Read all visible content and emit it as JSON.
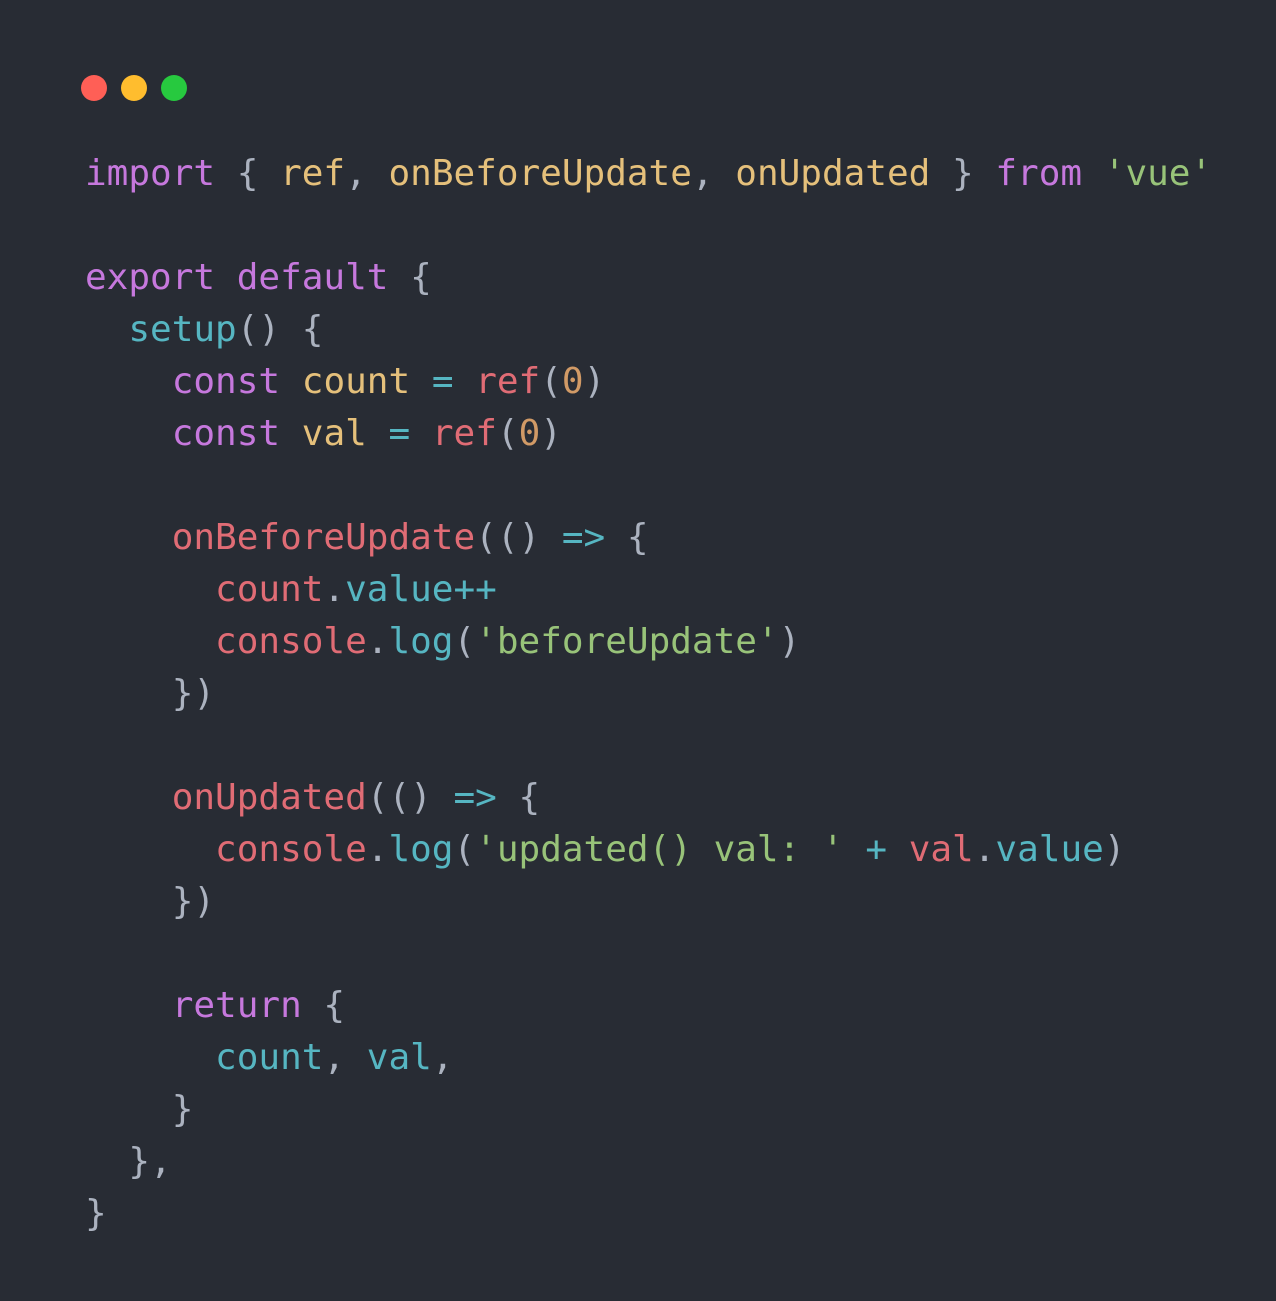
{
  "window": {
    "controls": {
      "close_color": "#ff5f56",
      "minimize_color": "#ffbd2e",
      "zoom_color": "#27c93f"
    }
  },
  "code": {
    "language": "javascript",
    "lines": [
      [
        {
          "t": "import",
          "c": "keyword"
        },
        {
          "t": " { ",
          "c": "punct"
        },
        {
          "t": "ref",
          "c": "import"
        },
        {
          "t": ", ",
          "c": "punct"
        },
        {
          "t": "onBeforeUpdate",
          "c": "import"
        },
        {
          "t": ", ",
          "c": "punct"
        },
        {
          "t": "onUpdated",
          "c": "import"
        },
        {
          "t": " } ",
          "c": "punct"
        },
        {
          "t": "from",
          "c": "keyword"
        },
        {
          "t": " ",
          "c": "plain"
        },
        {
          "t": "'vue'",
          "c": "string"
        }
      ],
      [],
      [
        {
          "t": "export",
          "c": "keyword"
        },
        {
          "t": " ",
          "c": "plain"
        },
        {
          "t": "default",
          "c": "keyword"
        },
        {
          "t": " {",
          "c": "punct"
        }
      ],
      [
        {
          "t": "  ",
          "c": "plain"
        },
        {
          "t": "setup",
          "c": "func"
        },
        {
          "t": "() {",
          "c": "punct"
        }
      ],
      [
        {
          "t": "    ",
          "c": "plain"
        },
        {
          "t": "const",
          "c": "keyword"
        },
        {
          "t": " ",
          "c": "plain"
        },
        {
          "t": "count",
          "c": "decl"
        },
        {
          "t": " ",
          "c": "plain"
        },
        {
          "t": "=",
          "c": "op"
        },
        {
          "t": " ",
          "c": "plain"
        },
        {
          "t": "ref",
          "c": "var"
        },
        {
          "t": "(",
          "c": "punct"
        },
        {
          "t": "0",
          "c": "num"
        },
        {
          "t": ")",
          "c": "punct"
        }
      ],
      [
        {
          "t": "    ",
          "c": "plain"
        },
        {
          "t": "const",
          "c": "keyword"
        },
        {
          "t": " ",
          "c": "plain"
        },
        {
          "t": "val",
          "c": "decl"
        },
        {
          "t": " ",
          "c": "plain"
        },
        {
          "t": "=",
          "c": "op"
        },
        {
          "t": " ",
          "c": "plain"
        },
        {
          "t": "ref",
          "c": "var"
        },
        {
          "t": "(",
          "c": "punct"
        },
        {
          "t": "0",
          "c": "num"
        },
        {
          "t": ")",
          "c": "punct"
        }
      ],
      [],
      [
        {
          "t": "    ",
          "c": "plain"
        },
        {
          "t": "onBeforeUpdate",
          "c": "var"
        },
        {
          "t": "(() ",
          "c": "punct"
        },
        {
          "t": "=>",
          "c": "op"
        },
        {
          "t": " {",
          "c": "punct"
        }
      ],
      [
        {
          "t": "      ",
          "c": "plain"
        },
        {
          "t": "count",
          "c": "var"
        },
        {
          "t": ".",
          "c": "punct"
        },
        {
          "t": "value",
          "c": "prop"
        },
        {
          "t": "++",
          "c": "op"
        }
      ],
      [
        {
          "t": "      ",
          "c": "plain"
        },
        {
          "t": "console",
          "c": "var"
        },
        {
          "t": ".",
          "c": "punct"
        },
        {
          "t": "log",
          "c": "func"
        },
        {
          "t": "(",
          "c": "punct"
        },
        {
          "t": "'beforeUpdate'",
          "c": "string"
        },
        {
          "t": ")",
          "c": "punct"
        }
      ],
      [
        {
          "t": "    ",
          "c": "plain"
        },
        {
          "t": "})",
          "c": "punct"
        }
      ],
      [],
      [
        {
          "t": "    ",
          "c": "plain"
        },
        {
          "t": "onUpdated",
          "c": "var"
        },
        {
          "t": "(() ",
          "c": "punct"
        },
        {
          "t": "=>",
          "c": "op"
        },
        {
          "t": " {",
          "c": "punct"
        }
      ],
      [
        {
          "t": "      ",
          "c": "plain"
        },
        {
          "t": "console",
          "c": "var"
        },
        {
          "t": ".",
          "c": "punct"
        },
        {
          "t": "log",
          "c": "func"
        },
        {
          "t": "(",
          "c": "punct"
        },
        {
          "t": "'updated() val: '",
          "c": "string"
        },
        {
          "t": " ",
          "c": "plain"
        },
        {
          "t": "+",
          "c": "op"
        },
        {
          "t": " ",
          "c": "plain"
        },
        {
          "t": "val",
          "c": "var"
        },
        {
          "t": ".",
          "c": "punct"
        },
        {
          "t": "value",
          "c": "prop"
        },
        {
          "t": ")",
          "c": "punct"
        }
      ],
      [
        {
          "t": "    ",
          "c": "plain"
        },
        {
          "t": "})",
          "c": "punct"
        }
      ],
      [],
      [
        {
          "t": "    ",
          "c": "plain"
        },
        {
          "t": "return",
          "c": "keyword"
        },
        {
          "t": " {",
          "c": "punct"
        }
      ],
      [
        {
          "t": "      ",
          "c": "plain"
        },
        {
          "t": "count",
          "c": "prop"
        },
        {
          "t": ", ",
          "c": "punct"
        },
        {
          "t": "val",
          "c": "prop"
        },
        {
          "t": ",",
          "c": "punct"
        }
      ],
      [
        {
          "t": "    ",
          "c": "plain"
        },
        {
          "t": "}",
          "c": "punct"
        }
      ],
      [
        {
          "t": "  ",
          "c": "plain"
        },
        {
          "t": "},",
          "c": "punct"
        }
      ],
      [
        {
          "t": "}",
          "c": "punct"
        }
      ]
    ]
  }
}
